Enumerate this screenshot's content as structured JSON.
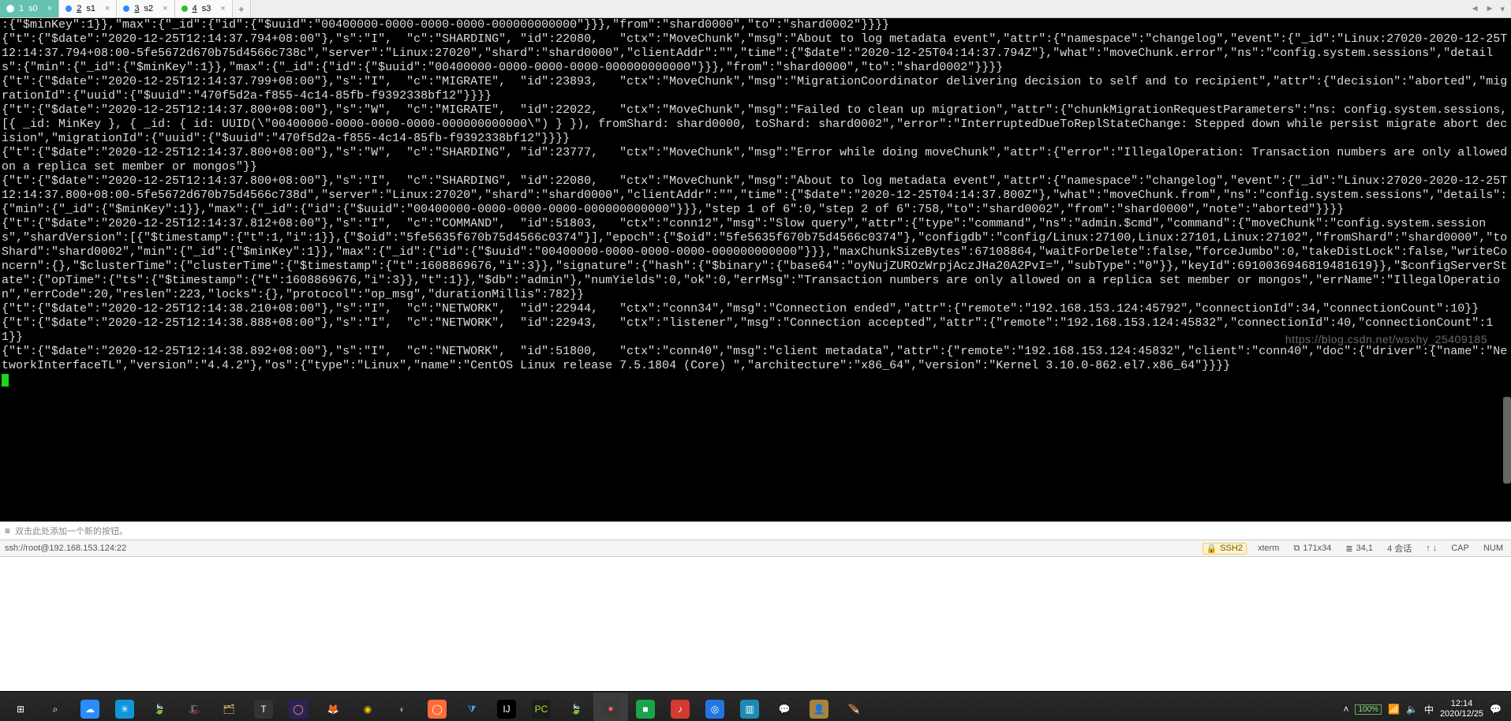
{
  "tabs": [
    {
      "index": "1",
      "label": "s0",
      "dot": "#ffffff",
      "active": true
    },
    {
      "index": "2",
      "label": "s1",
      "dot": "#2b8cff",
      "active": false
    },
    {
      "index": "3",
      "label": "s2",
      "dot": "#2b8cff",
      "active": false
    },
    {
      "index": "4",
      "label": "s3",
      "dot": "#2cbf2c",
      "active": false
    }
  ],
  "add_tab": "+",
  "nav_left": "◄",
  "nav_right": "►",
  "nav_menu": "▾",
  "log_lines": [
    ":{\"$minKey\":1}},\"max\":{\"_id\":{\"id\":{\"$uuid\":\"00400000-0000-0000-0000-000000000000\"}}},\"from\":\"shard0000\",\"to\":\"shard0002\"}}}}",
    "{\"t\":{\"$date\":\"2020-12-25T12:14:37.794+08:00\"},\"s\":\"I\",  \"c\":\"SHARDING\", \"id\":22080,   \"ctx\":\"MoveChunk\",\"msg\":\"About to log metadata event\",\"attr\":{\"namespace\":\"changelog\",\"event\":{\"_id\":\"Linux:27020-2020-12-25T12:14:37.794+08:00-5fe5672d670b75d4566c738c\",\"server\":\"Linux:27020\",\"shard\":\"shard0000\",\"clientAddr\":\"\",\"time\":{\"$date\":\"2020-12-25T04:14:37.794Z\"},\"what\":\"moveChunk.error\",\"ns\":\"config.system.sessions\",\"details\":{\"min\":{\"_id\":{\"$minKey\":1}},\"max\":{\"_id\":{\"id\":{\"$uuid\":\"00400000-0000-0000-0000-000000000000\"}}},\"from\":\"shard0000\",\"to\":\"shard0002\"}}}}",
    "{\"t\":{\"$date\":\"2020-12-25T12:14:37.799+08:00\"},\"s\":\"I\",  \"c\":\"MIGRATE\",  \"id\":23893,   \"ctx\":\"MoveChunk\",\"msg\":\"MigrationCoordinator delivering decision to self and to recipient\",\"attr\":{\"decision\":\"aborted\",\"migrationId\":{\"uuid\":{\"$uuid\":\"470f5d2a-f855-4c14-85fb-f9392338bf12\"}}}}",
    "{\"t\":{\"$date\":\"2020-12-25T12:14:37.800+08:00\"},\"s\":\"W\",  \"c\":\"MIGRATE\",  \"id\":22022,   \"ctx\":\"MoveChunk\",\"msg\":\"Failed to clean up migration\",\"attr\":{\"chunkMigrationRequestParameters\":\"ns: config.system.sessions, [{ _id: MinKey }, { _id: { id: UUID(\\\"00400000-0000-0000-0000-000000000000\\\") } }), fromShard: shard0000, toShard: shard0002\",\"error\":\"InterruptedDueToReplStateChange: Stepped down while persist migrate abort decision\",\"migrationId\":{\"uuid\":{\"$uuid\":\"470f5d2a-f855-4c14-85fb-f9392338bf12\"}}}}",
    "{\"t\":{\"$date\":\"2020-12-25T12:14:37.800+08:00\"},\"s\":\"W\",  \"c\":\"SHARDING\", \"id\":23777,   \"ctx\":\"MoveChunk\",\"msg\":\"Error while doing moveChunk\",\"attr\":{\"error\":\"IllegalOperation: Transaction numbers are only allowed on a replica set member or mongos\"}}",
    "{\"t\":{\"$date\":\"2020-12-25T12:14:37.800+08:00\"},\"s\":\"I\",  \"c\":\"SHARDING\", \"id\":22080,   \"ctx\":\"MoveChunk\",\"msg\":\"About to log metadata event\",\"attr\":{\"namespace\":\"changelog\",\"event\":{\"_id\":\"Linux:27020-2020-12-25T12:14:37.800+08:00-5fe5672d670b75d4566c738d\",\"server\":\"Linux:27020\",\"shard\":\"shard0000\",\"clientAddr\":\"\",\"time\":{\"$date\":\"2020-12-25T04:14:37.800Z\"},\"what\":\"moveChunk.from\",\"ns\":\"config.system.sessions\",\"details\":{\"min\":{\"_id\":{\"$minKey\":1}},\"max\":{\"_id\":{\"id\":{\"$uuid\":\"00400000-0000-0000-0000-000000000000\"}}},\"step 1 of 6\":0,\"step 2 of 6\":758,\"to\":\"shard0002\",\"from\":\"shard0000\",\"note\":\"aborted\"}}}}",
    "{\"t\":{\"$date\":\"2020-12-25T12:14:37.812+08:00\"},\"s\":\"I\",  \"c\":\"COMMAND\",  \"id\":51803,   \"ctx\":\"conn12\",\"msg\":\"Slow query\",\"attr\":{\"type\":\"command\",\"ns\":\"admin.$cmd\",\"command\":{\"moveChunk\":\"config.system.sessions\",\"shardVersion\":[{\"$timestamp\":{\"t\":1,\"i\":1}},{\"$oid\":\"5fe5635f670b75d4566c0374\"}],\"epoch\":{\"$oid\":\"5fe5635f670b75d4566c0374\"},\"configdb\":\"config/Linux:27100,Linux:27101,Linux:27102\",\"fromShard\":\"shard0000\",\"toShard\":\"shard0002\",\"min\":{\"_id\":{\"$minKey\":1}},\"max\":{\"_id\":{\"id\":{\"$uuid\":\"00400000-0000-0000-0000-000000000000\"}}},\"maxChunkSizeBytes\":67108864,\"waitForDelete\":false,\"forceJumbo\":0,\"takeDistLock\":false,\"writeConcern\":{},\"$clusterTime\":{\"clusterTime\":{\"$timestamp\":{\"t\":1608869676,\"i\":3}},\"signature\":{\"hash\":{\"$binary\":{\"base64\":\"oyNujZUROzWrpjAczJHa20A2PvI=\",\"subType\":\"0\"}},\"keyId\":6910036946819481619}},\"$configServerState\":{\"opTime\":{\"ts\":{\"$timestamp\":{\"t\":1608869676,\"i\":3}},\"t\":1}},\"$db\":\"admin\"},\"numYields\":0,\"ok\":0,\"errMsg\":\"Transaction numbers are only allowed on a replica set member or mongos\",\"errName\":\"IllegalOperation\",\"errCode\":20,\"reslen\":223,\"locks\":{},\"protocol\":\"op_msg\",\"durationMillis\":782}}",
    "{\"t\":{\"$date\":\"2020-12-25T12:14:38.210+08:00\"},\"s\":\"I\",  \"c\":\"NETWORK\",  \"id\":22944,   \"ctx\":\"conn34\",\"msg\":\"Connection ended\",\"attr\":{\"remote\":\"192.168.153.124:45792\",\"connectionId\":34,\"connectionCount\":10}}",
    "{\"t\":{\"$date\":\"2020-12-25T12:14:38.888+08:00\"},\"s\":\"I\",  \"c\":\"NETWORK\",  \"id\":22943,   \"ctx\":\"listener\",\"msg\":\"Connection accepted\",\"attr\":{\"remote\":\"192.168.153.124:45832\",\"connectionId\":40,\"connectionCount\":11}}",
    "{\"t\":{\"$date\":\"2020-12-25T12:14:38.892+08:00\"},\"s\":\"I\",  \"c\":\"NETWORK\",  \"id\":51800,   \"ctx\":\"conn40\",\"msg\":\"client metadata\",\"attr\":{\"remote\":\"192.168.153.124:45832\",\"client\":\"conn40\",\"doc\":{\"driver\":{\"name\":\"NetworkInterfaceTL\",\"version\":\"4.4.2\"},\"os\":{\"type\":\"Linux\",\"name\":\"CentOS Linux release 7.5.1804 (Core) \",\"architecture\":\"x86_64\",\"version\":\"Kernel 3.10.0-862.el7.x86_64\"}}}}"
  ],
  "hint": {
    "icon": "≡",
    "text": "双击此处添加一个新的按钮。"
  },
  "status": {
    "connection": "ssh://root@192.168.153.124:22",
    "ssh": "SSH2",
    "term": "xterm",
    "size": "171x34",
    "pos": "34,1",
    "sessions": "4 会话",
    "cap": "CAP",
    "num": "NUM",
    "arrows": "↑ ↓"
  },
  "taskbar": {
    "items": [
      {
        "name": "start",
        "glyph": "⊞",
        "bg": "transparent",
        "fg": "#ffffff"
      },
      {
        "name": "search",
        "glyph": "⌕",
        "bg": "transparent",
        "fg": "#ffffff"
      },
      {
        "name": "baidu-netdisk",
        "glyph": "☁",
        "bg": "#2c8cff",
        "fg": "#ffffff"
      },
      {
        "name": "tencent",
        "glyph": "✳",
        "bg": "#1296db",
        "fg": "#ffffff"
      },
      {
        "name": "mongodb",
        "glyph": "🍃",
        "bg": "transparent",
        "fg": "#5cc95c"
      },
      {
        "name": "redhat",
        "glyph": "🎩",
        "bg": "transparent",
        "fg": "#cc0000"
      },
      {
        "name": "file-manager",
        "glyph": "🗂",
        "bg": "transparent",
        "fg": "#f0c96b"
      },
      {
        "name": "typora",
        "glyph": "T",
        "bg": "#333333",
        "fg": "#ffffff"
      },
      {
        "name": "eclipse",
        "glyph": "◯",
        "bg": "#2c2255",
        "fg": "#ffb24d"
      },
      {
        "name": "firefox",
        "glyph": "🦊",
        "bg": "transparent",
        "fg": "#ff7139"
      },
      {
        "name": "chrome",
        "glyph": "◉",
        "bg": "transparent",
        "fg": "#f1c40f"
      },
      {
        "name": "html-viewer",
        "glyph": "◐",
        "bg": "transparent",
        "fg": "#6aa2cc"
      },
      {
        "name": "postman",
        "glyph": "◯",
        "bg": "#ff6c37",
        "fg": "#ffffff"
      },
      {
        "name": "vscode",
        "glyph": "⧩",
        "bg": "transparent",
        "fg": "#3ea6ff"
      },
      {
        "name": "intellij",
        "glyph": "IJ",
        "bg": "#000000",
        "fg": "#ffffff"
      },
      {
        "name": "pycharm",
        "glyph": "PC",
        "bg": "#1c1c1c",
        "fg": "#a7e22e"
      },
      {
        "name": "leaf-app",
        "glyph": "🍃",
        "bg": "transparent",
        "fg": "#7ab648"
      },
      {
        "name": "xshell",
        "glyph": "●",
        "bg": "#3a3a3a",
        "fg": "#ff5a5a"
      },
      {
        "name": "app-green",
        "glyph": "■",
        "bg": "#1aa34a",
        "fg": "#ffffff"
      },
      {
        "name": "netease-music",
        "glyph": "♪",
        "bg": "#d33a31",
        "fg": "#ffffff"
      },
      {
        "name": "app-blue",
        "glyph": "◎",
        "bg": "#2276e3",
        "fg": "#ffffff"
      },
      {
        "name": "vmware",
        "glyph": "▥",
        "bg": "#1e8ab3",
        "fg": "#ffffff"
      },
      {
        "name": "wechat",
        "glyph": "💬",
        "bg": "transparent",
        "fg": "#2dc100"
      },
      {
        "name": "avatar",
        "glyph": "👤",
        "bg": "#a8823f",
        "fg": "#ffffff"
      },
      {
        "name": "apache",
        "glyph": "🪶",
        "bg": "transparent",
        "fg": "#c1282d"
      }
    ],
    "active": "xshell",
    "tray": {
      "chevron": "˄",
      "battery": "100%",
      "net": "📶",
      "sound": "🔈",
      "lang": "中",
      "time": "12:14",
      "date": "2020/12/25",
      "notif": "💬"
    }
  },
  "watermark": "https://blog.csdn.net/wsxhy_25409185"
}
